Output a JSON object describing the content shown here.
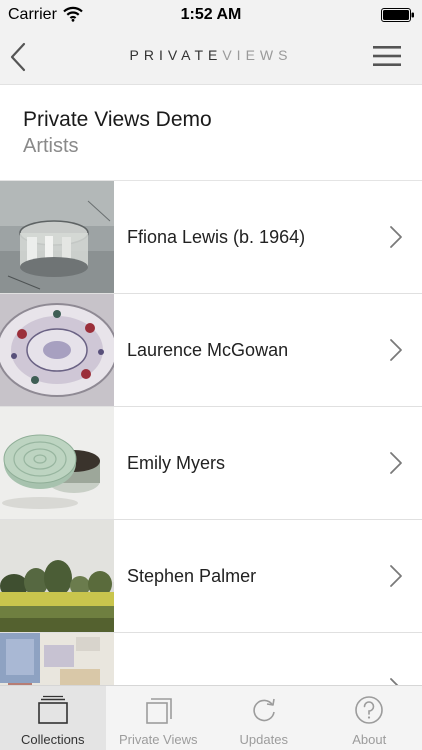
{
  "status": {
    "carrier": "Carrier",
    "time": "1:52 AM",
    "icons": [
      "wifi-icon",
      "battery-icon"
    ]
  },
  "nav": {
    "logo_strong": "PRIVATE",
    "logo_light": "VIEWS",
    "icons": [
      "back-chevron-icon",
      "hamburger-menu-icon"
    ]
  },
  "header": {
    "title": "Private Views Demo",
    "subtitle": "Artists"
  },
  "artists": [
    {
      "name": "Ffiona Lewis (b. 1964)",
      "thumb": "painting of glass bowl"
    },
    {
      "name": "Laurence McGowan",
      "thumb": "decorated ceramic plate"
    },
    {
      "name": "Emily Myers",
      "thumb": "green ceramic lidded box"
    },
    {
      "name": "Stephen Palmer",
      "thumb": "landscape painting"
    },
    {
      "name": "",
      "thumb": "abstract collage painting"
    }
  ],
  "tabs": [
    {
      "label": "Collections",
      "icon": "collections-icon",
      "active": true
    },
    {
      "label": "Private Views",
      "icon": "private-views-icon",
      "active": false
    },
    {
      "label": "Updates",
      "icon": "refresh-icon",
      "active": false
    },
    {
      "label": "About",
      "icon": "question-circle-icon",
      "active": false
    }
  ],
  "colors": {
    "bar_background": "#f2f2f2",
    "active_tab_background": "#e4e4e4",
    "inactive_tab_text": "#9c9c9c",
    "subtitle_text": "#8a8a8a"
  }
}
